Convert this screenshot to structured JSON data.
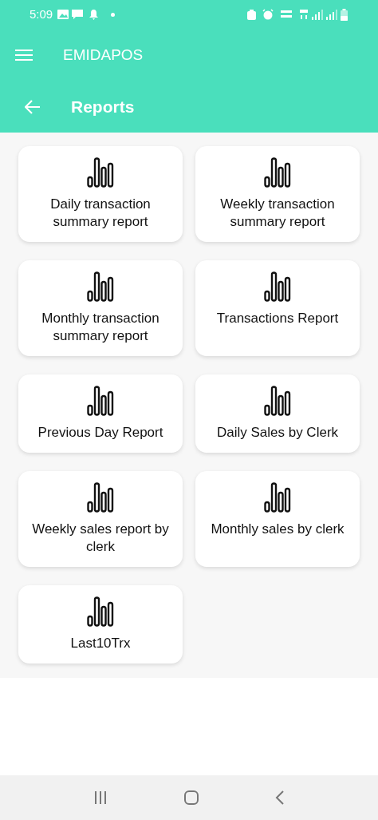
{
  "status_bar": {
    "time": "5:09"
  },
  "app_bar": {
    "title": "EMIDAPOS"
  },
  "page_header": {
    "title": "Reports"
  },
  "reports": [
    {
      "label": "Daily transaction summary report"
    },
    {
      "label": "Weekly transaction summary report"
    },
    {
      "label": "Monthly transaction summary report"
    },
    {
      "label": "Transactions Report"
    },
    {
      "label": "Previous Day Report"
    },
    {
      "label": "Daily Sales by Clerk"
    },
    {
      "label": "Weekly sales report by clerk"
    },
    {
      "label": "Monthly sales by clerk"
    },
    {
      "label": "Last10Trx"
    }
  ]
}
